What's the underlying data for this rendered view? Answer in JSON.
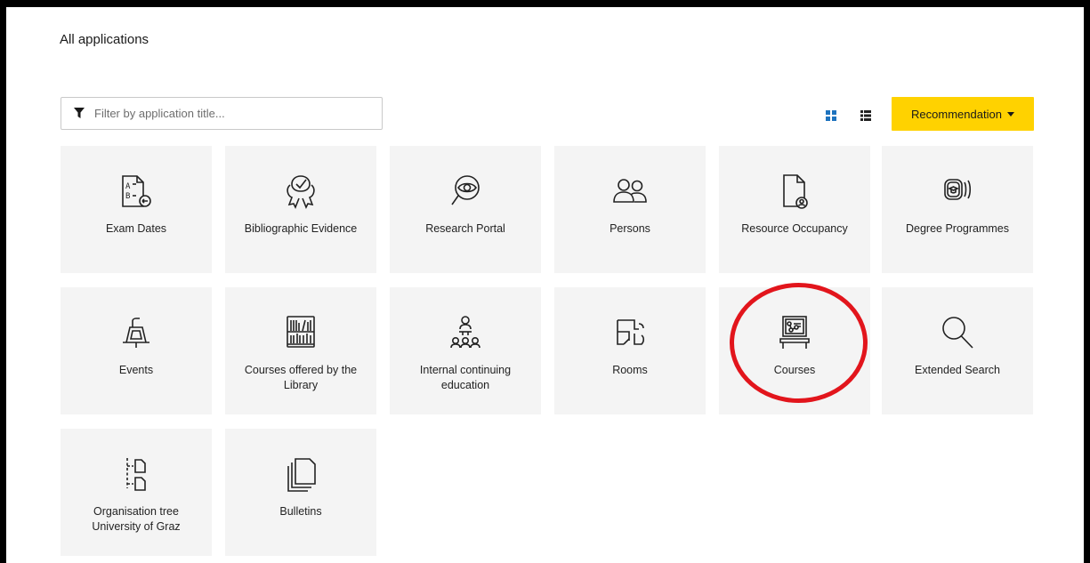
{
  "header": {
    "title": "All applications"
  },
  "filter": {
    "placeholder": "Filter by application title...",
    "value": "",
    "icon": "filter-icon"
  },
  "toolbar": {
    "grid_view_icon": "grid-view-icon",
    "list_view_icon": "list-view-icon",
    "sort_label": "Recommendation",
    "accent_color": "#ffd200",
    "active_icon_color": "#1e73be"
  },
  "apps": [
    {
      "label": "Exam Dates",
      "icon": "exam-dates-icon"
    },
    {
      "label": "Bibliographic Evidence",
      "icon": "bibliographic-evidence-icon"
    },
    {
      "label": "Research Portal",
      "icon": "research-portal-icon"
    },
    {
      "label": "Persons",
      "icon": "persons-icon"
    },
    {
      "label": "Resource Occupancy",
      "icon": "resource-occupancy-icon"
    },
    {
      "label": "Degree Programmes",
      "icon": "degree-programmes-icon"
    },
    {
      "label": "Events",
      "icon": "events-icon"
    },
    {
      "label": "Courses offered by the Library",
      "icon": "library-courses-icon"
    },
    {
      "label": "Internal continuing education",
      "icon": "continuing-education-icon"
    },
    {
      "label": "Rooms",
      "icon": "rooms-icon"
    },
    {
      "label": "Courses",
      "icon": "courses-icon"
    },
    {
      "label": "Extended Search",
      "icon": "extended-search-icon"
    },
    {
      "label": "Organisation tree University of Graz",
      "icon": "organisation-tree-icon"
    },
    {
      "label": "Bulletins",
      "icon": "bulletins-icon"
    }
  ],
  "annotation": {
    "ring_color": "#e2151c",
    "highlighted_app": "Courses"
  }
}
